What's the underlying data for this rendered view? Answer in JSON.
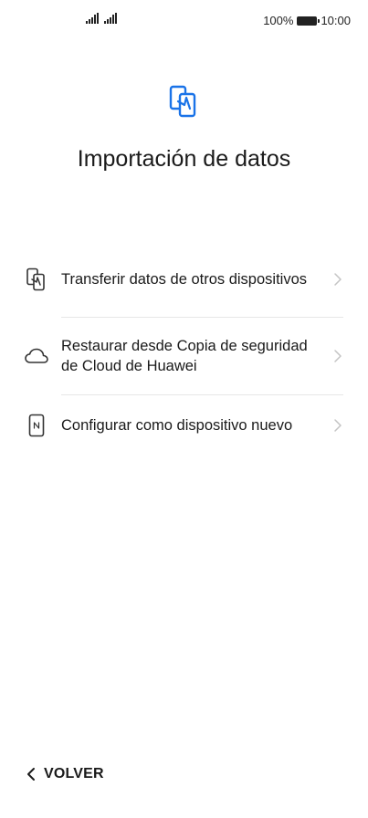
{
  "status_bar": {
    "battery_percent": "100%",
    "time": "10:00",
    "signal_icons": [
      "signal-icon",
      "signal-icon"
    ],
    "battery_icon": "battery-icon"
  },
  "header": {
    "icon": "phone-transfer-icon",
    "accent_color": "#1a73e8",
    "title": "Importación de datos"
  },
  "options": [
    {
      "icon": "phone-transfer-icon",
      "label": "Transferir datos de otros dispositivos"
    },
    {
      "icon": "cloud-icon",
      "label": "Restaurar desde Copia de seguridad de Cloud de Huawei"
    },
    {
      "icon": "new-device-icon",
      "label": "Configurar como dispositivo nuevo"
    }
  ],
  "footer": {
    "back_label": "VOLVER",
    "back_icon": "chevron-left-icon"
  }
}
